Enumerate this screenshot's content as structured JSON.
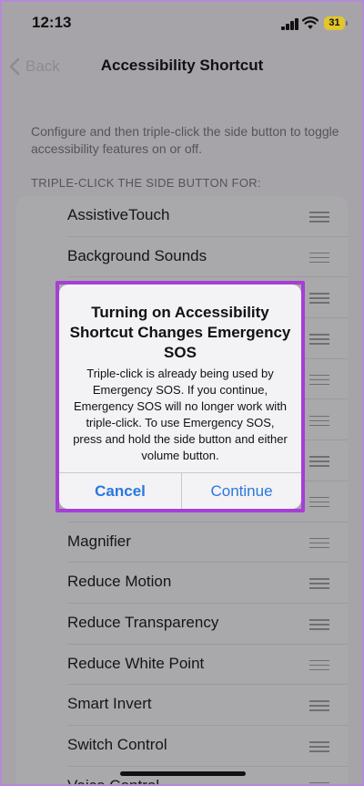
{
  "status_bar": {
    "time": "12:13",
    "battery": "31",
    "icons": [
      "signal-icon",
      "wifi-icon",
      "battery-icon"
    ]
  },
  "nav": {
    "back_label": "Back",
    "title": "Accessibility Shortcut"
  },
  "description": "Configure and then triple-click the side button to toggle accessibility features on or off.",
  "section_header": "TRIPLE-CLICK THE SIDE BUTTON FOR:",
  "list": {
    "items": [
      {
        "label": "AssistiveTouch"
      },
      {
        "label": "Background Sounds"
      },
      {
        "label": ""
      },
      {
        "label": ""
      },
      {
        "label": ""
      },
      {
        "label": ""
      },
      {
        "label": ""
      },
      {
        "label": ""
      },
      {
        "label": "Magnifier"
      },
      {
        "label": "Reduce Motion"
      },
      {
        "label": "Reduce Transparency"
      },
      {
        "label": "Reduce White Point"
      },
      {
        "label": "Smart Invert"
      },
      {
        "label": "Switch Control"
      },
      {
        "label": "Voice Control"
      }
    ]
  },
  "alert": {
    "title": "Turning on Accessibility Shortcut Changes Emergency SOS",
    "message": "Triple-click is already being used by Emergency SOS. If you continue, Emergency SOS will no longer work with triple-click. To use Emergency SOS, press and hold the side button and either volume button.",
    "cancel_label": "Cancel",
    "continue_label": "Continue"
  },
  "colors": {
    "accent": "#2a77e0",
    "highlight": "#a63ed6",
    "battery": "#e2c62a"
  }
}
